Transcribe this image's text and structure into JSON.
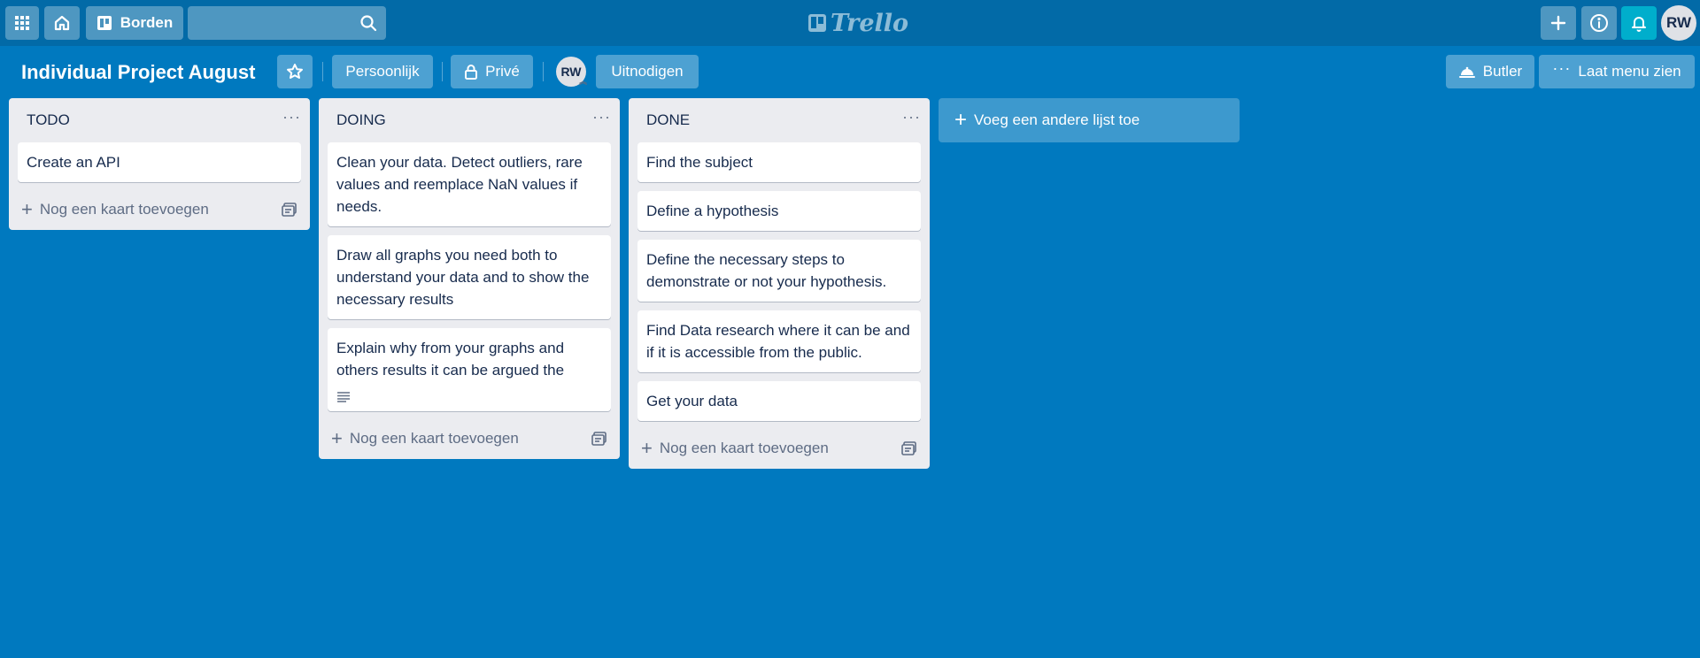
{
  "nav": {
    "boards_label": "Borden",
    "search_placeholder": "",
    "logo_text": "Trello",
    "user_initials": "RW"
  },
  "board": {
    "title": "Individual Project August",
    "personal_label": "Persoonlijk",
    "private_label": "Privé",
    "member_initials": "RW",
    "invite_label": "Uitnodigen",
    "butler_label": "Butler",
    "menu_label": "Laat menu zien",
    "add_list_label": "Voeg een andere lijst toe"
  },
  "lists": [
    {
      "title": "TODO",
      "cards": [
        "Create an API"
      ],
      "add_card_label": "Nog een kaart toevoegen"
    },
    {
      "title": "DOING",
      "cards": [
        "Clean your data. Detect outliers, rare values and reemplace NaN values if needs.",
        "Draw all graphs you need both to understand your data and to show the necessary results",
        "Explain why from your graphs and others results it can be argued the"
      ],
      "add_card_label": "Nog een kaart toevoegen"
    },
    {
      "title": "DONE",
      "cards": [
        "Find the subject",
        "Define a hypothesis",
        "Define the necessary steps to demonstrate or not your hypothesis.",
        "Find Data research where it can be and if it is accessible from the public.",
        "Get your data"
      ],
      "add_card_label": "Nog een kaart toevoegen"
    }
  ]
}
